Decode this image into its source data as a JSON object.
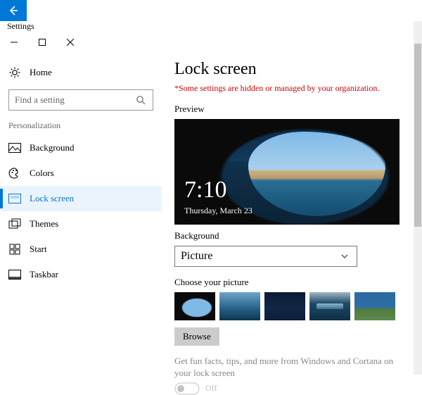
{
  "window": {
    "title": "Settings"
  },
  "home_label": "Home",
  "search": {
    "placeholder": "Find a setting"
  },
  "section": "Personalization",
  "nav": [
    {
      "label": "Background"
    },
    {
      "label": "Colors"
    },
    {
      "label": "Lock screen"
    },
    {
      "label": "Themes"
    },
    {
      "label": "Start"
    },
    {
      "label": "Taskbar"
    }
  ],
  "page": {
    "title": "Lock screen",
    "org_warning": "*Some settings are hidden or managed by your organization.",
    "preview_label": "Preview",
    "preview_time": "7:10",
    "preview_date": "Thursday, March 23",
    "background_label": "Background",
    "background_value": "Picture",
    "choose_label": "Choose your picture",
    "browse_label": "Browse",
    "fun_facts_label": "Get fun facts, tips, and more from Windows and Cortana on your lock screen",
    "fun_facts_state": "Off"
  }
}
